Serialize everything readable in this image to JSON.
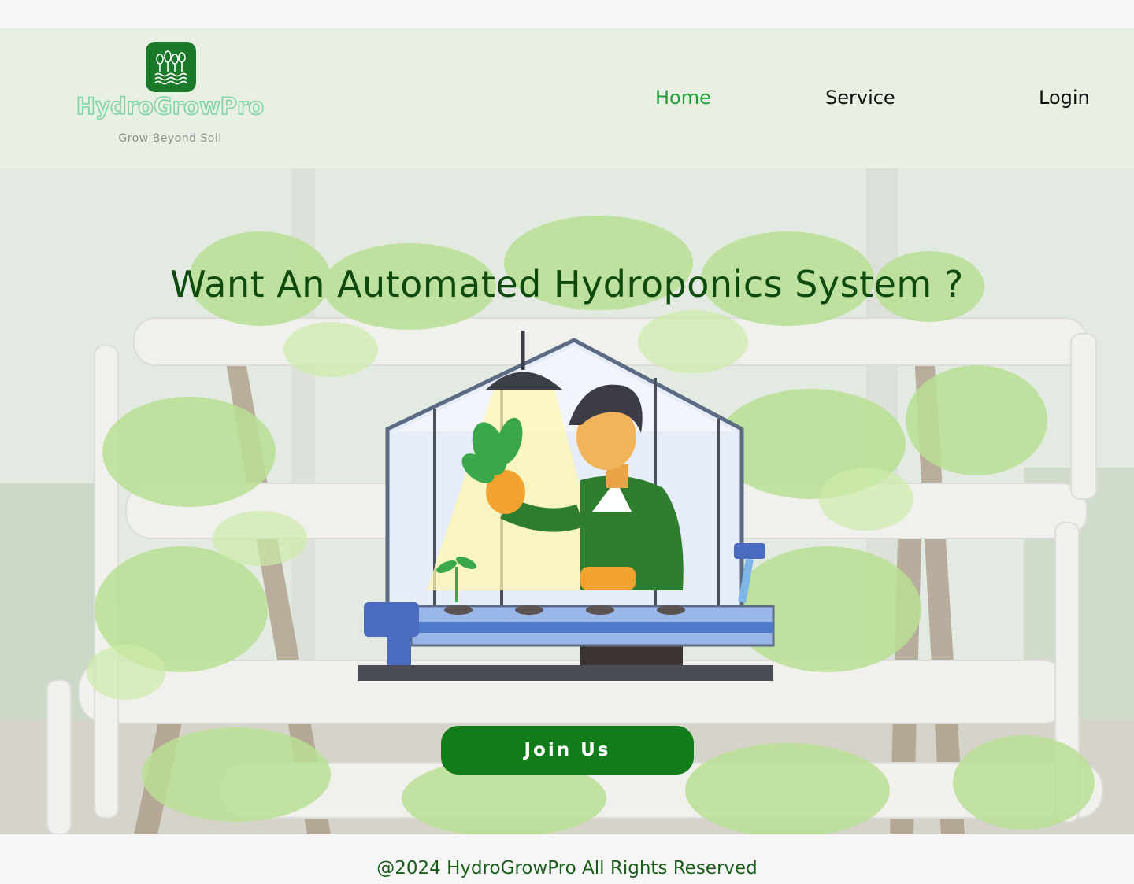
{
  "brand": {
    "name": "HydroGrowPro",
    "tagline": "Grow Beyond Soil",
    "logo_icon": "plants-water-icon",
    "badge_color": "#1b7a2a"
  },
  "nav": {
    "items": [
      {
        "label": "Home",
        "active": true
      },
      {
        "label": "Service",
        "active": false
      },
      {
        "label": "Login",
        "active": false
      }
    ],
    "active_color": "#22a03a"
  },
  "hero": {
    "title": "Want An Automated Hydroponics System ?",
    "illustration": "farmer-greenhouse-hydroponics-illustration",
    "cta_label": "Join Us",
    "cta_color": "#127c1a"
  },
  "footer": {
    "text": "@2024 HydroGrowPro All Rights Reserved"
  }
}
